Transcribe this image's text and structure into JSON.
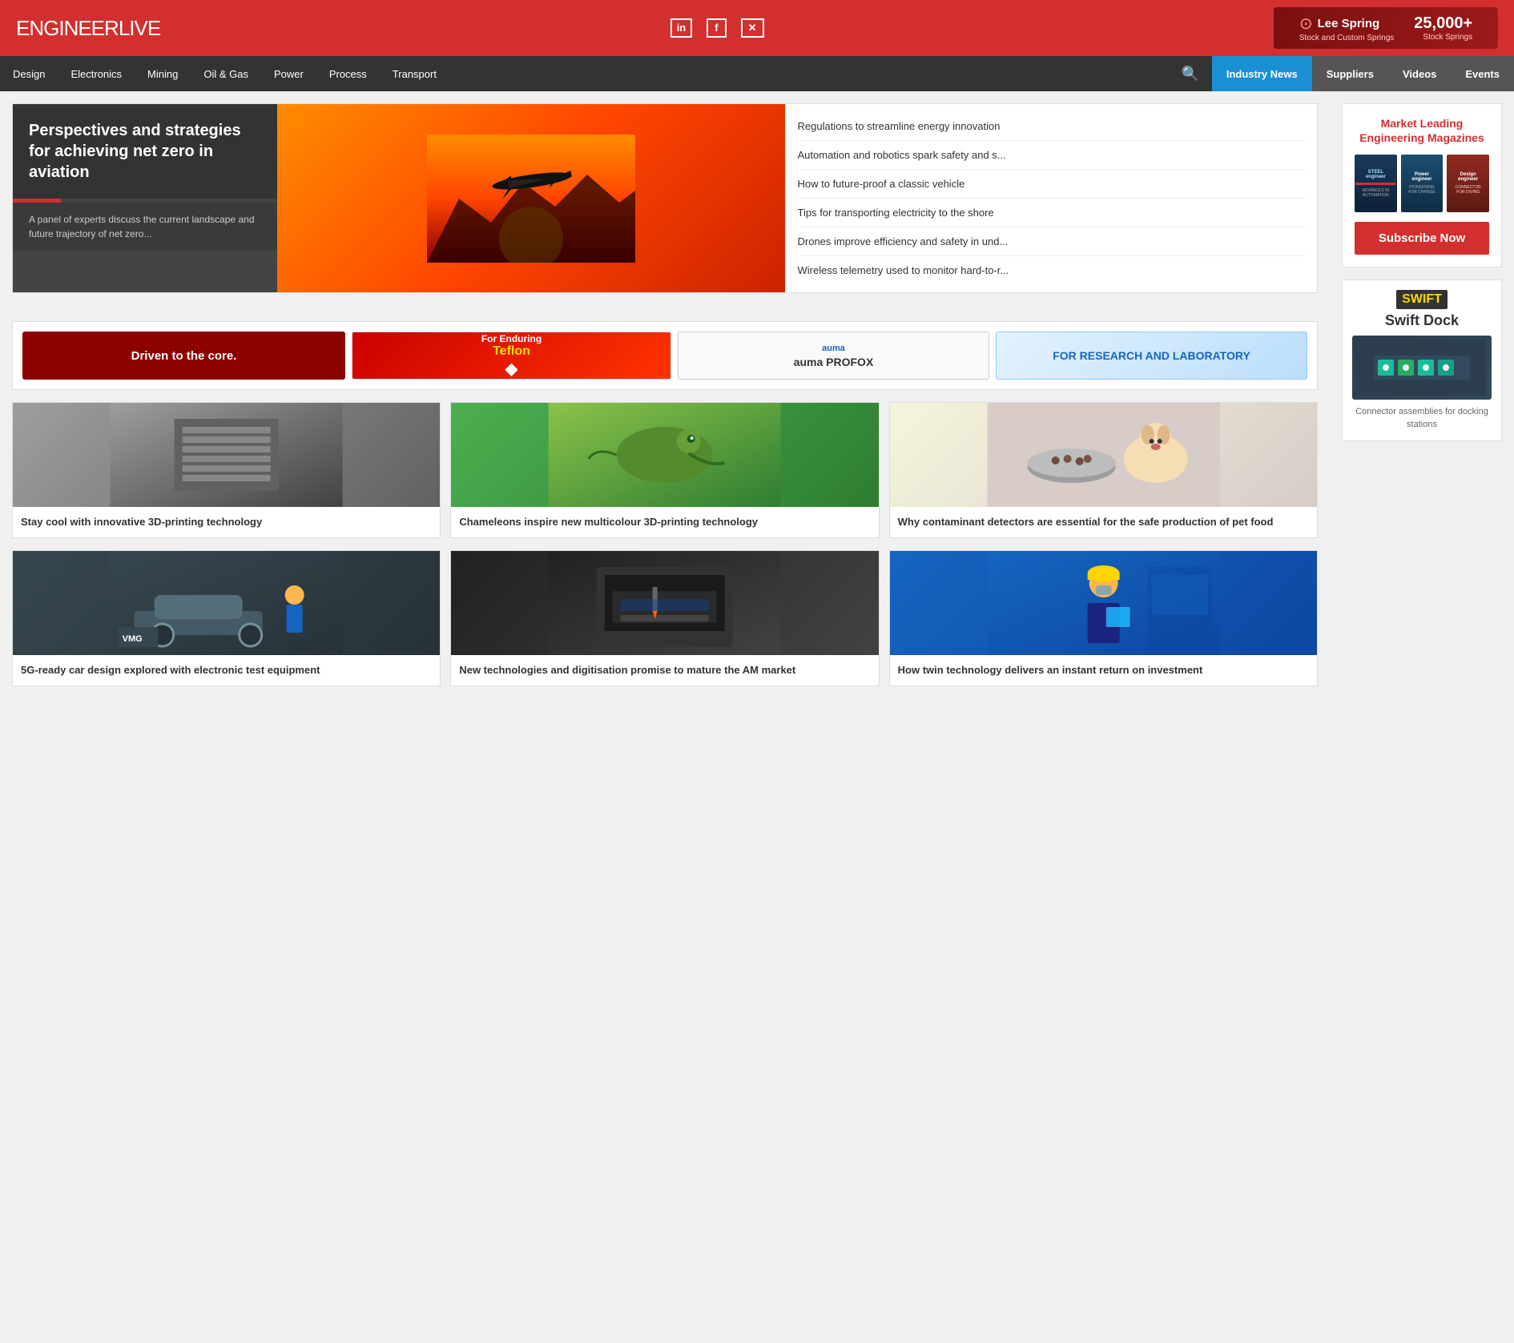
{
  "header": {
    "logo_main": "ENGINEER",
    "logo_sub": "LIVE",
    "social": [
      {
        "name": "linkedin",
        "icon": "in"
      },
      {
        "name": "facebook",
        "icon": "f"
      },
      {
        "name": "twitter-x",
        "icon": "✕"
      }
    ],
    "ad": {
      "brand": "Lee Spring",
      "tagline": "Stock and Custom Springs",
      "highlight": "25,000+",
      "highlight_sub": "Stock Springs"
    }
  },
  "nav": {
    "main_items": [
      {
        "label": "Design"
      },
      {
        "label": "Electronics"
      },
      {
        "label": "Mining"
      },
      {
        "label": "Oil & Gas"
      },
      {
        "label": "Power"
      },
      {
        "label": "Process"
      },
      {
        "label": "Transport"
      }
    ],
    "right_items": [
      {
        "label": "Industry News",
        "active": true
      },
      {
        "label": "Suppliers",
        "active": false
      },
      {
        "label": "Videos",
        "active": false
      },
      {
        "label": "Events",
        "active": false
      }
    ]
  },
  "hero": {
    "title": "Perspectives and strategies for achieving net zero in aviation",
    "description": "A panel of experts discuss the current landscape and future trajectory of net zero...",
    "article_list": [
      {
        "text": "Regulations to streamline energy innovation"
      },
      {
        "text": "Automation and robotics spark safety and s..."
      },
      {
        "text": "How to future-proof a classic vehicle"
      },
      {
        "text": "Tips for transporting electricity to the shore"
      },
      {
        "text": "Drones improve efficiency and safety in und..."
      },
      {
        "text": "Wireless telemetry used to monitor hard-to-r..."
      }
    ]
  },
  "sidebar": {
    "magazine_title": "Market Leading Engineering Magazines",
    "subscribe_label": "Subscribe Now"
  },
  "ad_banners": [
    {
      "label": "Driven to the core.",
      "type": "driven"
    },
    {
      "label": "For Enduring",
      "brand": "Teflon",
      "type": "teflon"
    },
    {
      "label": "auma PROFOX",
      "type": "profox"
    },
    {
      "label": "FOR RESEARCH AND LABORATORY",
      "type": "research"
    }
  ],
  "articles_row1": [
    {
      "title": "Stay cool with innovative 3D-printing technology",
      "img_type": "img-3dprint"
    },
    {
      "title": "Chameleons inspire new multicolour 3D-printing technology",
      "img_type": "img-chameleon"
    },
    {
      "title": "Why contaminant detectors are essential for the safe production of pet food",
      "img_type": "img-petfood"
    }
  ],
  "articles_row2": [
    {
      "title": "5G-ready car design explored with electronic test equipment",
      "img_type": "img-car"
    },
    {
      "title": "New technologies and digitisation promise to mature the AM market",
      "img_type": "img-3dprinter"
    },
    {
      "title": "How twin technology delivers an instant return on investment",
      "img_type": "img-worker"
    }
  ],
  "sidebar_ad": {
    "title": "Swift Dock",
    "subtitle": "Connector assemblies for docking stations"
  }
}
